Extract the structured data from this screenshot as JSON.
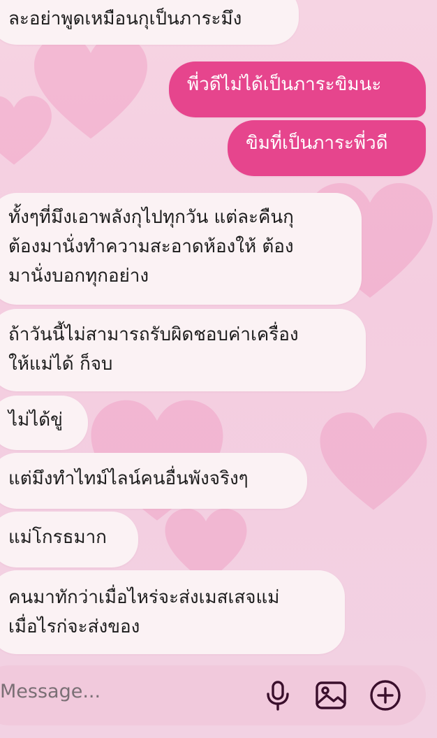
{
  "messages": [
    {
      "dir": "in",
      "text": "ละอย่าพูดเหมือนกุเป็นภาระมึง"
    },
    {
      "dir": "out",
      "text": "พี่วดีไม่ได้เป็นภาระขิมนะ"
    },
    {
      "dir": "out",
      "text": "ขิมที่เป็นภาระพี่วดี"
    },
    {
      "dir": "in",
      "text": "ทั้งๆที่มึงเอาพลังกุไปทุกวัน แต่ละคืนกุ\nต้องมานั่งทำความสะอาดห้องให้ ต้อง\nมานั่งบอกทุกอย่าง"
    },
    {
      "dir": "in",
      "text": "ถ้าวันนี้ไม่สามารถรับผิดชอบค่าเครื่อง\nให้แม่ได้ ก็จบ"
    },
    {
      "dir": "in",
      "text": "ไม่ได้ขู่"
    },
    {
      "dir": "in",
      "text": "แต่มึงทำไทม์ไลน์คนอื่นพังจริงๆ"
    },
    {
      "dir": "in",
      "text": "แม่โกรธมาก"
    },
    {
      "dir": "in",
      "text": "คนมาทักว่าเมื่อไหร่จะส่งเมสเสจแม่\nเมื่อไรก่จะส่งของ"
    }
  ],
  "input": {
    "placeholder": "Message...",
    "mic_icon": "microphone-icon",
    "image_icon": "image-icon",
    "add_icon": "plus-circle-icon"
  },
  "colors": {
    "incoming_bubble": "#fbf2f4",
    "outgoing_bubble": "#e6458d",
    "icon": "#3a0f2c"
  }
}
